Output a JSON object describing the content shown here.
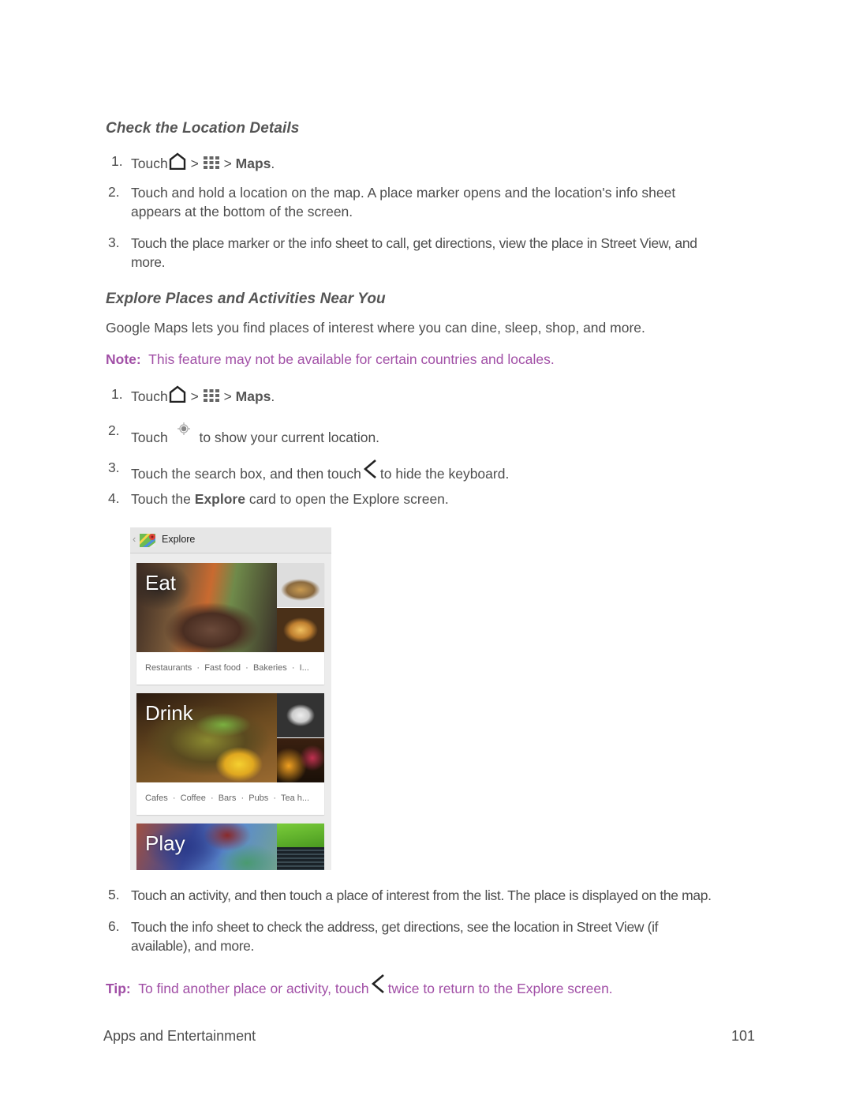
{
  "section1": {
    "heading": "Check the Location Details",
    "steps": [
      {
        "num": "1.",
        "pre": "Touch",
        "sep1": ">",
        "sep2": ">",
        "target": "Maps",
        "post": "."
      },
      {
        "num": "2.",
        "line1": "Touch and hold a location on the map. A place marker opens and the location's info sheet",
        "line2": "appears at the bottom of the screen."
      },
      {
        "num": "3.",
        "line1": "Touch the place marker or the info sheet to call, get directions, view the place in Street View, and",
        "line2": "more."
      }
    ]
  },
  "section2": {
    "heading": "Explore Places and Activities Near You",
    "intro": "Google Maps lets you find places of interest where you can dine, sleep, shop, and more.",
    "note_label": "Note:",
    "note_text": "This feature may not be available for certain countries and locales.",
    "steps": [
      {
        "num": "1.",
        "pre": "Touch",
        "sep1": ">",
        "sep2": ">",
        "target": "Maps",
        "post": "."
      },
      {
        "num": "2.",
        "pre": "Touch",
        "post": "to show your current location."
      },
      {
        "num": "3.",
        "pre": "Touch the search box, and then touch",
        "post": "to hide the keyboard."
      },
      {
        "num": "4.",
        "pre": "Touch the",
        "bold": "Explore",
        "post": "card to open the Explore screen."
      },
      {
        "num": "5.",
        "line1": "Touch an activity, and then touch a place of interest from the list. The place is displayed on the map."
      },
      {
        "num": "6.",
        "line1": "Touch the info sheet to check the address, get directions, see the location in Street View (if",
        "line2": "available), and more."
      }
    ],
    "tip_label": "Tip:",
    "tip_pre": "To find another place or activity, touch",
    "tip_post": "twice to return to the Explore screen."
  },
  "explore_screen": {
    "title": "Explore",
    "cards": [
      {
        "label": "Eat",
        "subtitle": "Restaurants  ·  Fast food  ·  Bakeries  ·  I..."
      },
      {
        "label": "Drink",
        "subtitle": "Cafes  ·  Coffee  ·  Bars  ·  Pubs  ·  Tea h..."
      },
      {
        "label": "Play",
        "subtitle": ""
      }
    ]
  },
  "footer": {
    "section": "Apps and Entertainment",
    "page": "101"
  },
  "colors": {
    "accent_purple": "#a14fa6",
    "body_text": "#4d4d4d"
  }
}
